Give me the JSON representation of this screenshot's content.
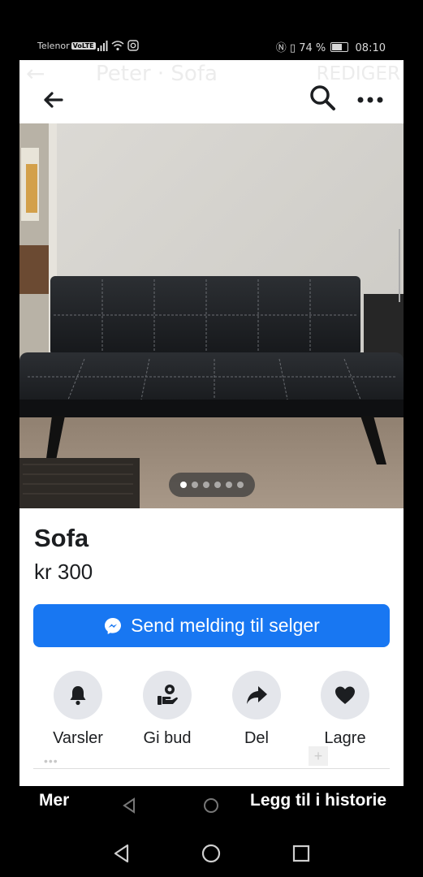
{
  "status_bar": {
    "carrier": "Telenor",
    "volte": "VoLTE",
    "battery_percent_text": "74 %",
    "battery_level": 0.74,
    "time": "08:10"
  },
  "overlay_header": {
    "back_ghost": "←",
    "title_ghost": "Peter · Sofa",
    "edit_ghost": "REDIGER"
  },
  "photo_pager": {
    "count": 6,
    "active_index": 0
  },
  "listing": {
    "title": "Sofa",
    "price": "kr 300"
  },
  "message_button": {
    "label": "Send melding til selger"
  },
  "actions": [
    {
      "label": "Varsler",
      "icon": "bell-icon"
    },
    {
      "label": "Gi bud",
      "icon": "offer-hand-icon"
    },
    {
      "label": "Del",
      "icon": "share-icon"
    },
    {
      "label": "Lagre",
      "icon": "heart-icon"
    }
  ],
  "story_bar": {
    "more_label": "Mer",
    "add_story_label": "Legg til i historie"
  },
  "colors": {
    "accent": "#1877f2",
    "icon_circle": "#e4e6eb",
    "text": "#1c1e21"
  }
}
